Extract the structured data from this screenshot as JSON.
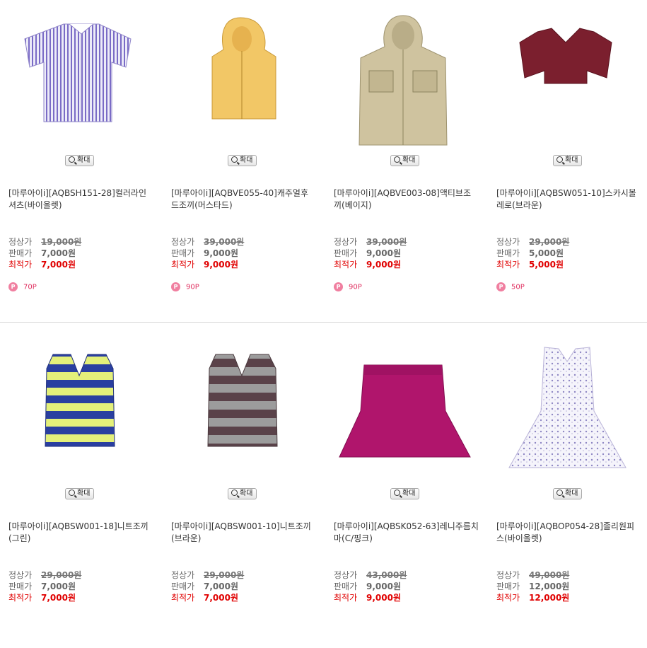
{
  "labels": {
    "regular": "정상가",
    "sale": "판매가",
    "best": "최적가",
    "zoom": "확대"
  },
  "rows": [
    [
      {
        "title": "[마루아이i][AQBSH151-28]컬러라인셔츠(바이올렛)",
        "regular": "19,000원",
        "sale": "7,000원",
        "best": "7,000원",
        "points": "70P",
        "image": "violet-striped-shirt",
        "color": "#7a6bc6"
      },
      {
        "title": "[마루아이i][AQBVE055-40]캐주얼후드조끼(머스타드)",
        "regular": "39,000원",
        "sale": "9,000원",
        "best": "9,000원",
        "points": "90P",
        "image": "mustard-hooded-vest",
        "color": "#f2c766"
      },
      {
        "title": "[마루아이i][AQBVE003-08]액티브조끼(베이지)",
        "regular": "39,000원",
        "sale": "9,000원",
        "best": "9,000원",
        "points": "90P",
        "image": "beige-active-vest",
        "color": "#cfc39f"
      },
      {
        "title": "[마루아이i][AQBSW051-10]스카시볼레로(브라운)",
        "regular": "29,000원",
        "sale": "5,000원",
        "best": "5,000원",
        "points": "50P",
        "image": "brown-bolero",
        "color": "#7b1f2e"
      }
    ],
    [
      {
        "title": "[마루아이i][AQBSW001-18]니트조끼(그린)",
        "regular": "29,000원",
        "sale": "7,000원",
        "best": "7,000원",
        "image": "green-knit-vest",
        "color": "#2a3fa0"
      },
      {
        "title": "[마루아이i][AQBSW001-10]니트조끼(브라운)",
        "regular": "29,000원",
        "sale": "7,000원",
        "best": "7,000원",
        "image": "brown-knit-vest",
        "color": "#5a4249"
      },
      {
        "title": "[마루아이i][AQBSK052-63]레니주름치마(C/핑크)",
        "regular": "43,000원",
        "sale": "9,000원",
        "best": "9,000원",
        "image": "pink-pleated-skirt",
        "color": "#b0156c"
      },
      {
        "title": "[마루아이i][AQBOP054-28]졸리원피스(바이올렛)",
        "regular": "49,000원",
        "sale": "12,000원",
        "best": "12,000원",
        "image": "violet-floral-dress",
        "color": "#b9b3d8"
      }
    ]
  ]
}
